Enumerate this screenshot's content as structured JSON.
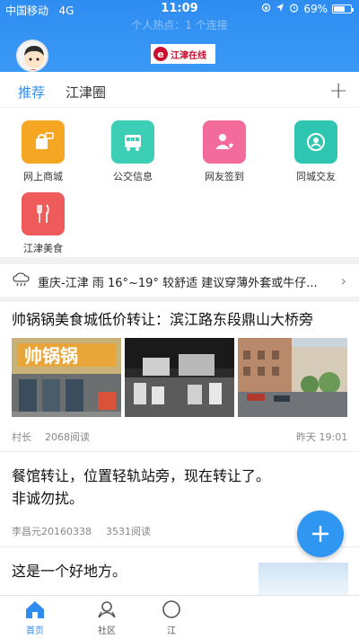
{
  "status_bar": {
    "carrier": "中国移动",
    "network": "4G",
    "time": "11:09",
    "battery": "69%",
    "battery_level": 0.69,
    "hotspot": "个人热点：1 个连接"
  },
  "header": {
    "logo_letter": "e",
    "logo_text": "江津在线"
  },
  "tabs": [
    {
      "label": "推荐"
    },
    {
      "label": "江津圈"
    }
  ],
  "grid": [
    {
      "label": "网上商城",
      "color": "#f5a623",
      "icon": "shopping-icon"
    },
    {
      "label": "公交信息",
      "color": "#3ccfb6",
      "icon": "bus-icon"
    },
    {
      "label": "网友签到",
      "color": "#f26b9a",
      "icon": "checkin-icon"
    },
    {
      "label": "同城交友",
      "color": "#2ec6b0",
      "icon": "friend-icon"
    },
    {
      "label": "江津美食",
      "color": "#ef5b5b",
      "icon": "food-icon"
    }
  ],
  "weather": {
    "text": "重庆-江津 雨 16°~19° 较舒适 建议穿薄外套或牛仔..."
  },
  "posts": [
    {
      "title": "帅锅锅美食城低价转让：滨江路东段鼎山大桥旁",
      "author": "村长",
      "reads": "2068阅读",
      "time": "昨天 19:01"
    },
    {
      "title_line1": "餐馆转让，位置轻轨站旁，现在转让了。",
      "title_line2": "非诚勿扰。",
      "author": "李昌元20160338",
      "reads": "3531阅读"
    },
    {
      "title": "这是一个好地方。"
    }
  ],
  "bottom_nav": [
    {
      "label": "首页",
      "icon": "home-icon",
      "active": true
    },
    {
      "label": "社区",
      "icon": "community-icon",
      "active": false
    },
    {
      "label": "江",
      "icon": "jiang-icon",
      "active": false
    }
  ]
}
